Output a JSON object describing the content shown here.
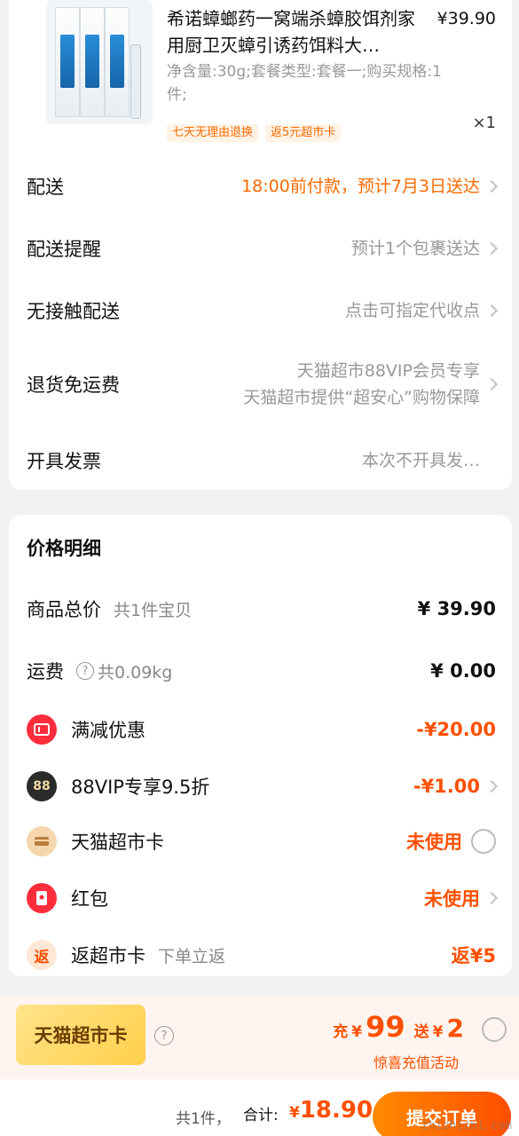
{
  "product": {
    "title": "希诺蟑螂药一窝端杀蟑胶饵剂家用厨卫灭蟑引诱药饵料大…",
    "price": "¥39.90",
    "spec": "净含量:30g;套餐类型:套餐一;购买规格:1件;",
    "tags": [
      "七天无理由退换",
      "返5元超市卡"
    ],
    "quantity": "×1"
  },
  "order_rows": [
    {
      "label": "配送",
      "value": "18:00前付款，预计7月3日送达"
    },
    {
      "label": "配送提醒",
      "value": "预计1个包裹送达"
    },
    {
      "label": "无接触配送",
      "value": "点击可指定代收点"
    },
    {
      "label": "退货免运费",
      "value_line1": "天猫超市88VIP会员专享",
      "value_line2": "天猫超市提供“超安心”购物保障"
    },
    {
      "label": "开具发票",
      "value": "本次不开具发…"
    }
  ],
  "price_detail": {
    "title": "价格明细",
    "rows": [
      {
        "name": "商品总价",
        "sub": "共1件宝贝",
        "amount": "¥ 39.90"
      },
      {
        "name": "运费",
        "sub": "共0.09kg",
        "amount": "¥ 0.00"
      },
      {
        "name": "满减优惠",
        "amount": "-¥20.00",
        "icon": "discount-ticket-icon",
        "icon_color": "#ff2d3c"
      },
      {
        "name": "88VIP专享9.5折",
        "amount": "-¥1.00",
        "icon": "88vip-icon",
        "icon_text": "88",
        "icon_color": "#2b2b2b"
      },
      {
        "name": "天猫超市卡",
        "amount": "未使用",
        "icon": "card-icon",
        "icon_color": "#f0c48a"
      },
      {
        "name": "红包",
        "amount": "未使用",
        "icon": "red-packet-icon",
        "icon_color": "#ff2d3c"
      },
      {
        "name": "返超市卡",
        "sub": "下单立返",
        "amount": "返¥5",
        "icon": "return-icon",
        "icon_text": "返",
        "icon_color": "#ffe7d6"
      }
    ]
  },
  "promo": {
    "badge": "天猫超市卡",
    "recharge_prefix": "充",
    "recharge_currency": "¥",
    "recharge_amount": "99",
    "bonus_prefix": "送",
    "bonus_currency": "¥",
    "bonus_amount": "2",
    "note": "惊喜充值活动"
  },
  "bottom": {
    "count": "共1件，",
    "total_label": "合计:",
    "total_currency": "¥",
    "total_amount": "18.90",
    "submit": "提交订单"
  },
  "watermark": "zhizhizhi.com",
  "colors": {
    "accent": "#ff5000",
    "orange_text": "#ff6a00",
    "muted": "#999999"
  }
}
